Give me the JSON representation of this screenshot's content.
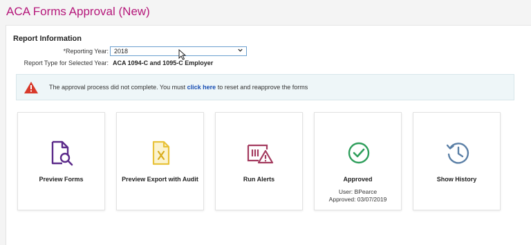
{
  "page": {
    "title": "ACA Forms Approval (New)"
  },
  "report": {
    "heading": "Report Information",
    "year_label": "*Reporting Year:",
    "year_value": "2018",
    "type_label": "Report Type for Selected Year:",
    "type_value": "ACA 1094-C and 1095-C Employer"
  },
  "alert": {
    "message_before": "The approval process did not complete. You must",
    "link_text": "click here",
    "message_after": "to reset and reapprove the forms"
  },
  "cards": [
    {
      "label": "Preview Forms",
      "icon": "document-search-icon"
    },
    {
      "label": "Preview Export with Audit",
      "icon": "excel-file-icon"
    },
    {
      "label": "Run Alerts",
      "icon": "alert-warning-icon"
    },
    {
      "label": "Approved",
      "icon": "check-circle-icon",
      "user": "User: BPearce",
      "approved": "Approved: 03/07/2019"
    },
    {
      "label": "Show History",
      "icon": "history-clock-icon"
    }
  ],
  "colors": {
    "title": "#b5177a",
    "preview_forms_icon": "#5b2a8a",
    "export_icon": "#e8c23a",
    "alerts_icon": "#a33a5e",
    "approved_icon": "#2e9e5b",
    "history_icon": "#5a7fa6",
    "alert_icon": "#d83a2b",
    "link": "#1a4fb3"
  }
}
